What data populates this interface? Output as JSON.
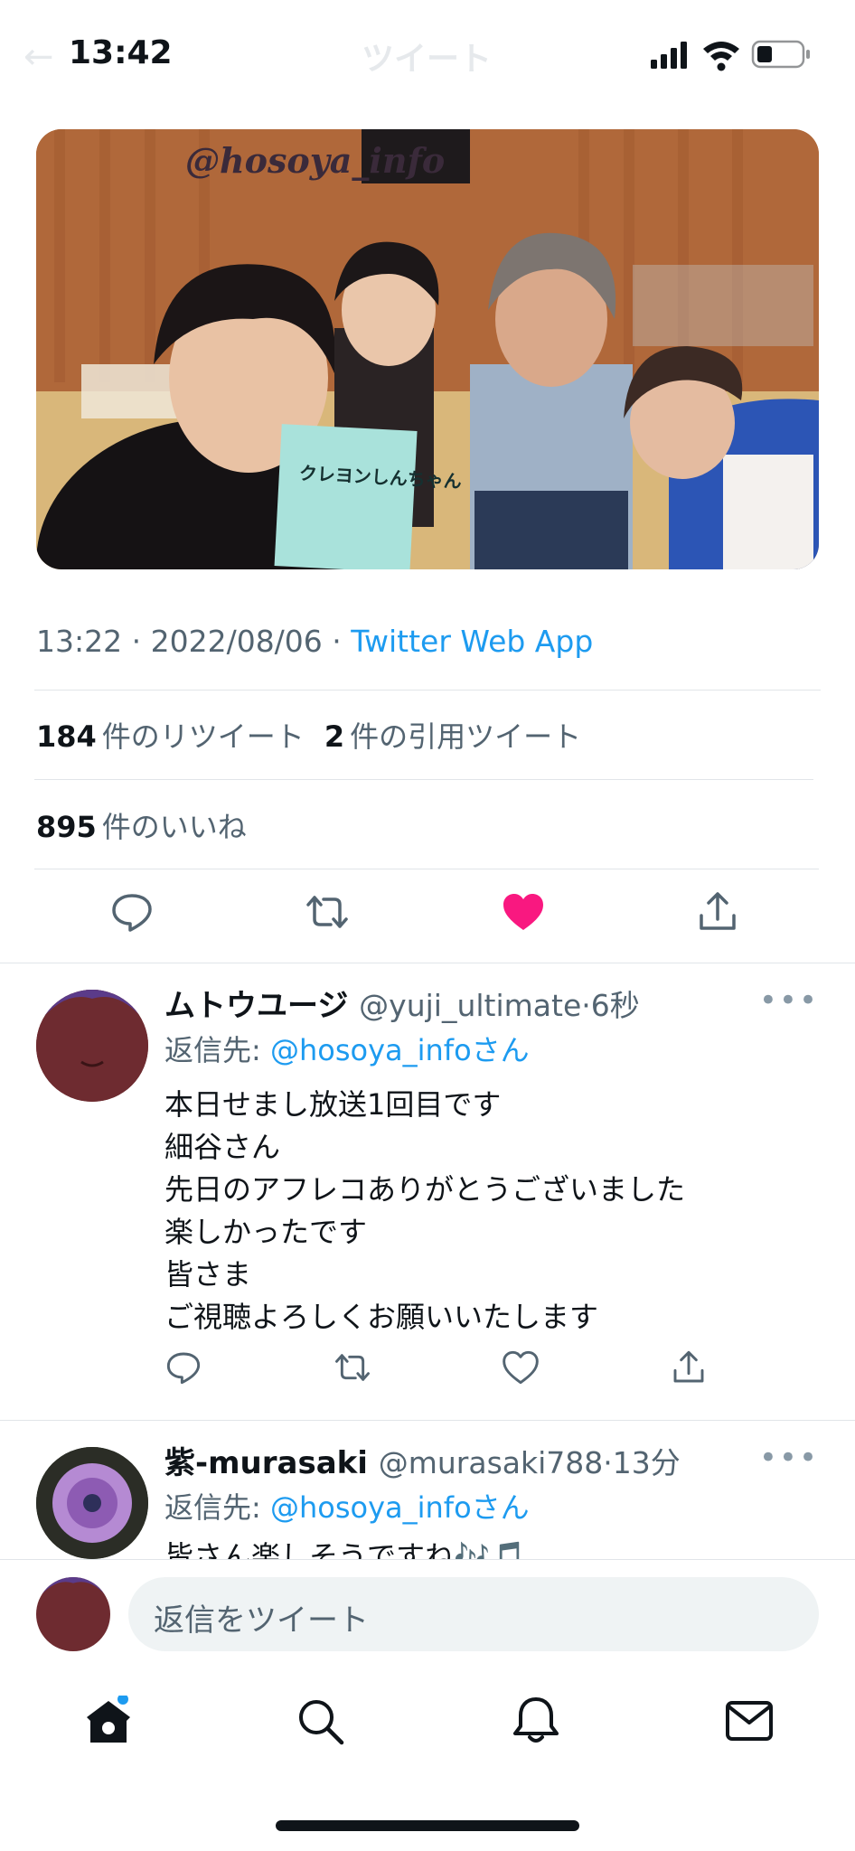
{
  "status_bar": {
    "time": "13:42",
    "faded_title": "ツイート"
  },
  "photo": {
    "watermark": "@hosoya_info",
    "script_text": "クレヨンしんちゃん"
  },
  "tweet": {
    "time": "13:22",
    "date": "2022/08/06",
    "source": "Twitter Web App",
    "retweet_count": "184",
    "retweet_label": "件のリツイート",
    "quote_count": "2",
    "quote_label": "件の引用ツイート",
    "like_count": "895",
    "like_label": "件のいいね"
  },
  "replies": [
    {
      "name": "ムトウユージ",
      "handle": "@yuji_ultimate",
      "time": "6秒",
      "reply_to_label": "返信先: ",
      "reply_to_handle": "@hosoya_infoさん",
      "body": "本日せまし放送1回目です\n細谷さん\n先日のアフレコありがとうございました\n楽しかったです\n皆さま\nご視聴よろしくお願いいたします"
    },
    {
      "name": "紫-murasaki",
      "handle": "@murasaki788",
      "time": "13分",
      "reply_to_label": "返信先: ",
      "reply_to_handle": "@hosoya_infoさん",
      "body": "皆さん楽しそうですね🎶🎵"
    }
  ],
  "compose": {
    "placeholder": "返信をツイート"
  },
  "icons": {
    "tweet_actions": [
      "reply-icon",
      "retweet-icon",
      "like-icon-filled",
      "share-icon"
    ],
    "tabbar": [
      "home-icon",
      "search-icon",
      "notifications-icon",
      "messages-icon"
    ]
  },
  "colors": {
    "accent": "#1d9bf0",
    "like": "#f91880",
    "text": "#0f1419",
    "muted": "#536471"
  }
}
